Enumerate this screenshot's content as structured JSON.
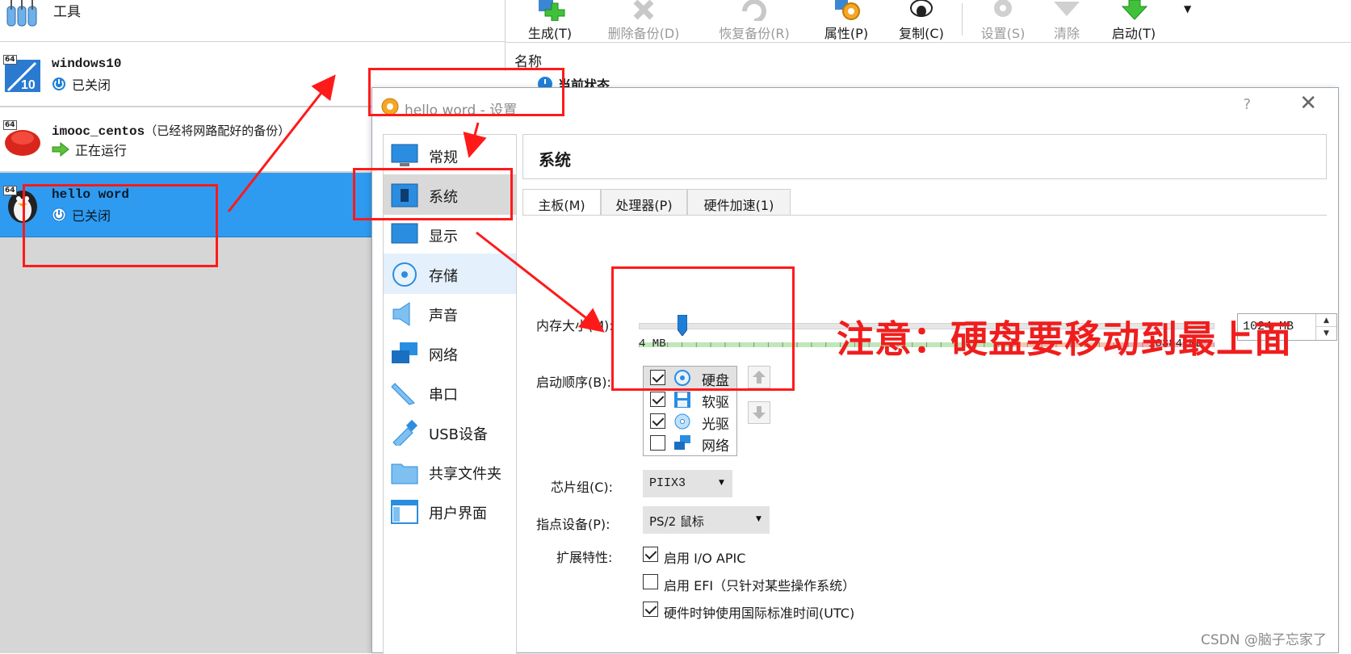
{
  "left_panel": {
    "tools_label": "工具",
    "vms": [
      {
        "name": "windows10",
        "note": "",
        "state": "已关闭"
      },
      {
        "name": "imooc_centos",
        "note": "（已经将网路配好的备份）",
        "state": "正在运行"
      },
      {
        "name": "hello word",
        "note": "",
        "state": "已关闭"
      }
    ],
    "arch_badge": "64"
  },
  "toolbar": {
    "create": "生成(T)",
    "delete_backup": "删除备份(D)",
    "restore_backup": "恢复备份(R)",
    "properties": "属性(P)",
    "clone": "复制(C)",
    "settings": "设置(S)",
    "discard": "清除",
    "start": "启动(T)"
  },
  "details": {
    "name_header": "名称",
    "current_state": "当前状态"
  },
  "dialog": {
    "title": "hello word - 设置",
    "help": "?",
    "nav": [
      "常规",
      "系统",
      "显示",
      "存储",
      "声音",
      "网络",
      "串口",
      "USB设备",
      "共享文件夹",
      "用户界面"
    ],
    "section_title": "系统",
    "tabs": [
      "主板(M)",
      "处理器(P)",
      "硬件加速(1)"
    ],
    "memory_label": "内存大小(M):",
    "memory_value": "1024 MB",
    "memory_min": "4 MB",
    "memory_max": "16384 MB",
    "memory_fraction": 0.0623,
    "boot_label": "启动顺序(B):",
    "boot_order": [
      {
        "label": "硬盘",
        "checked": true
      },
      {
        "label": "软驱",
        "checked": true
      },
      {
        "label": "光驱",
        "checked": true
      },
      {
        "label": "网络",
        "checked": false
      }
    ],
    "chipset_label": "芯片组(C):",
    "chipset_value": "PIIX3",
    "pointing_label": "指点设备(P):",
    "pointing_value": "PS/2 鼠标",
    "features_label": "扩展特性:",
    "features": [
      {
        "label": "启用 I/O APIC",
        "checked": true
      },
      {
        "label": "启用 EFI（只针对某些操作系统）",
        "checked": false
      },
      {
        "label": "硬件时钟使用国际标准时间(UTC)",
        "checked": true
      }
    ]
  },
  "annotation": {
    "note": "注意：硬盘要移动到最上面",
    "color": "#f01d1d"
  },
  "watermark": "CSDN @脑子忘家了"
}
